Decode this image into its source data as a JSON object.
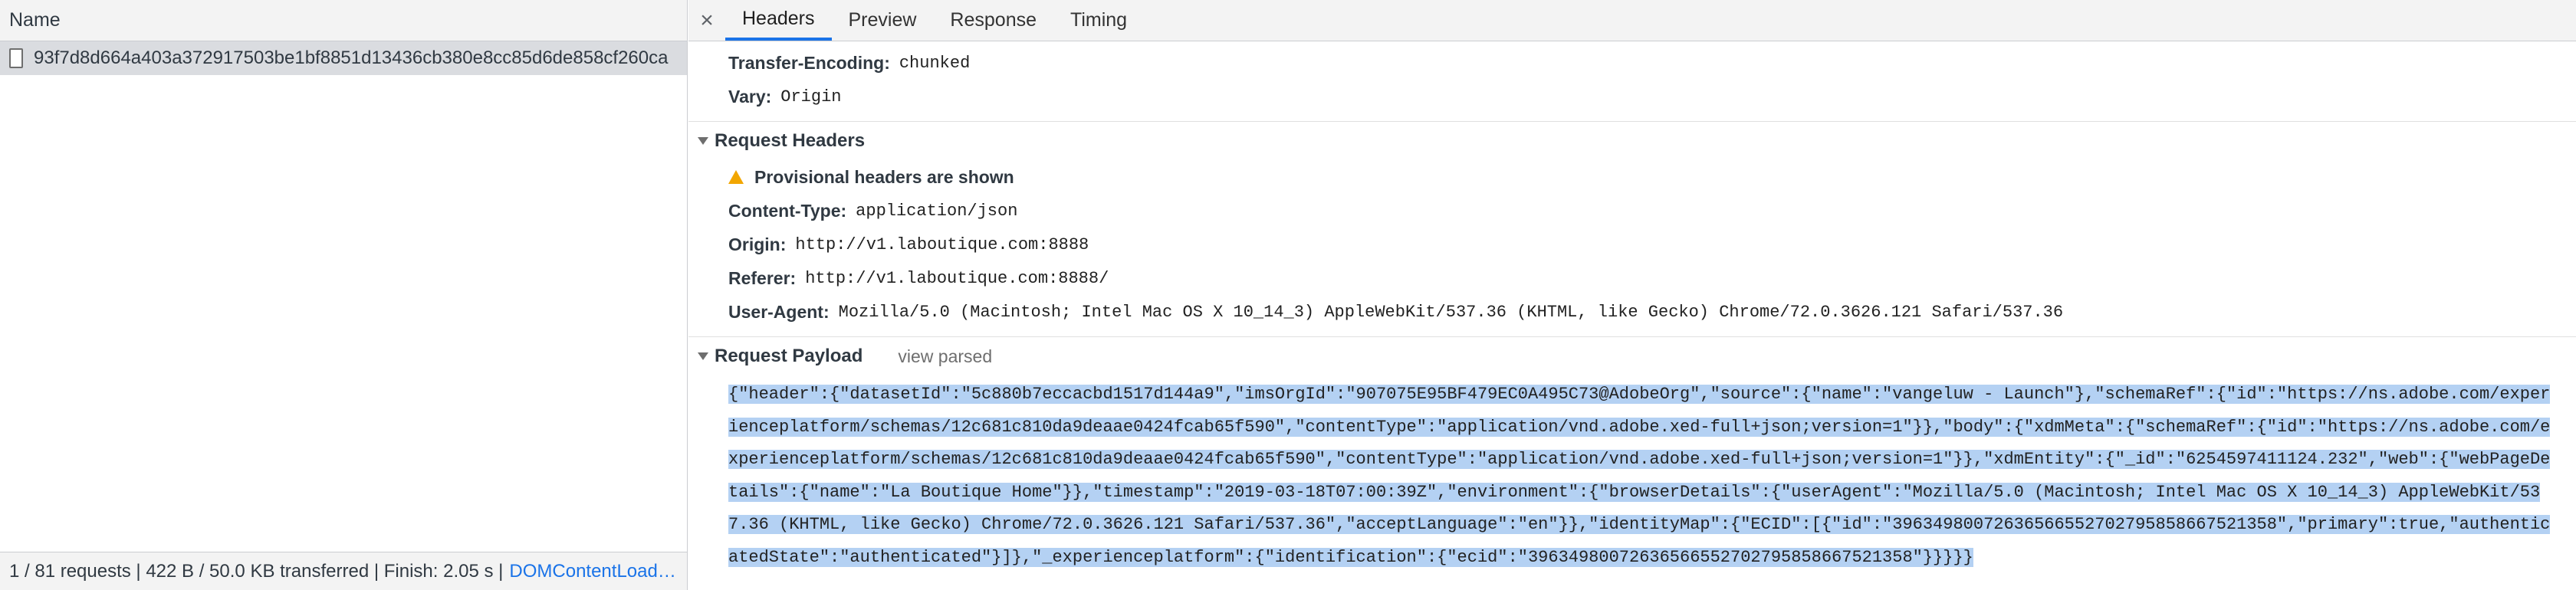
{
  "left_panel": {
    "column_header": "Name",
    "request_name": "93f7d8d664a403a372917503be1bf8851d13436cb380e8cc85d6de858cf260ca",
    "status_bar": {
      "summary": "1 / 81 requests | 422 B / 50.0 KB transferred | Finish: 2.05 s |",
      "link": "DOMContentLoad…"
    }
  },
  "tabs": {
    "close_glyph": "×",
    "items": [
      "Headers",
      "Preview",
      "Response",
      "Timing"
    ],
    "active": "Headers"
  },
  "response_headers_tail": [
    {
      "name": "Transfer-Encoding:",
      "value": "chunked"
    },
    {
      "name": "Vary:",
      "value": "Origin"
    }
  ],
  "request_headers": {
    "title": "Request Headers",
    "warning": "Provisional headers are shown",
    "items": [
      {
        "name": "Content-Type:",
        "value": "application/json"
      },
      {
        "name": "Origin:",
        "value": "http://v1.laboutique.com:8888"
      },
      {
        "name": "Referer:",
        "value": "http://v1.laboutique.com:8888/"
      },
      {
        "name": "User-Agent:",
        "value": "Mozilla/5.0 (Macintosh; Intel Mac OS X 10_14_3) AppleWebKit/537.36 (KHTML, like Gecko) Chrome/72.0.3626.121 Safari/537.36"
      }
    ]
  },
  "request_payload": {
    "title": "Request Payload",
    "view_parsed": "view parsed",
    "body": "{\"header\":{\"datasetId\":\"5c880b7eccacbd1517d144a9\",\"imsOrgId\":\"907075E95BF479EC0A495C73@AdobeOrg\",\"source\":{\"name\":\"vangeluw - Launch\"},\"schemaRef\":{\"id\":\"https://ns.adobe.com/experienceplatform/schemas/12c681c810da9deaae0424fcab65f590\",\"contentType\":\"application/vnd.adobe.xed-full+json;version=1\"}},\"body\":{\"xdmMeta\":{\"schemaRef\":{\"id\":\"https://ns.adobe.com/experienceplatform/schemas/12c681c810da9deaae0424fcab65f590\",\"contentType\":\"application/vnd.adobe.xed-full+json;version=1\"}},\"xdmEntity\":{\"_id\":\"6254597411124.232\",\"web\":{\"webPageDetails\":{\"name\":\"La Boutique Home\"}},\"timestamp\":\"2019-03-18T07:00:39Z\",\"environment\":{\"browserDetails\":{\"userAgent\":\"Mozilla/5.0 (Macintosh; Intel Mac OS X 10_14_3) AppleWebKit/537.36 (KHTML, like Gecko) Chrome/72.0.3626.121 Safari/537.36\",\"acceptLanguage\":\"en\"}},\"identityMap\":{\"ECID\":[{\"id\":\"39634980072636566552702795858667521358\",\"primary\":true,\"authenticatedState\":\"authenticated\"}]},\"_experienceplatform\":{\"identification\":{\"ecid\":\"39634980072636566552702795858667521358\"}}}}}"
  },
  "colors": {
    "active_tab_underline": "#1a73e8",
    "selection": "#b4d1f3",
    "selected_row": "#dadce0",
    "warning": "#f2a600",
    "link": "#1a73e8"
  },
  "icons": [
    "file-icon",
    "close-icon",
    "disclosure-triangle-icon",
    "warning-icon"
  ]
}
